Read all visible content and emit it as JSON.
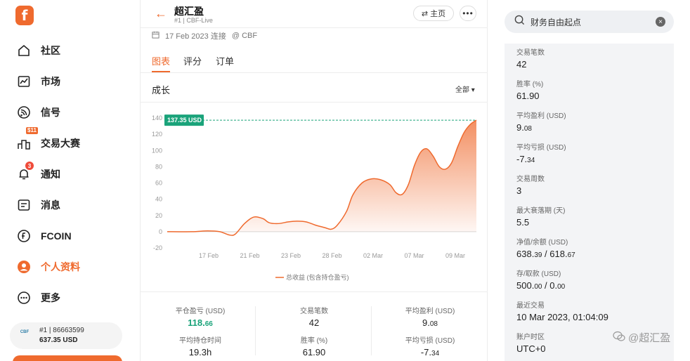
{
  "sidebar": {
    "logo_letter": "f",
    "items": [
      {
        "label": "社区",
        "icon": "home-icon"
      },
      {
        "label": "市场",
        "icon": "chart-icon"
      },
      {
        "label": "信号",
        "icon": "signal-icon"
      },
      {
        "label": "交易大赛",
        "icon": "podium-icon",
        "tag": "$11"
      },
      {
        "label": "通知",
        "icon": "bell-icon",
        "badge": "3"
      },
      {
        "label": "消息",
        "icon": "message-icon"
      },
      {
        "label": "FCOIN",
        "icon": "fcoin-icon"
      },
      {
        "label": "个人资料",
        "icon": "user-icon"
      },
      {
        "label": "更多",
        "icon": "more-icon"
      }
    ],
    "account": {
      "logo_text": "CBF",
      "id_line": "#1 | 86663599",
      "balance": "637.35 USD"
    }
  },
  "header": {
    "title": "超汇盈",
    "subtitle": "#1 | CBF-Live",
    "home_label": "⇄ 主页",
    "meta_date": "17 Feb 2023 连接",
    "meta_broker": "@ CBF"
  },
  "tabs": [
    "图表",
    "评分",
    "订单"
  ],
  "growth": {
    "title": "成长",
    "filter": "全部"
  },
  "chart_data": {
    "type": "area",
    "x_ticks": [
      "17 Feb",
      "21 Feb",
      "23 Feb",
      "28 Feb",
      "02 Mar",
      "07 Mar",
      "09 Mar"
    ],
    "y_ticks": [
      "140",
      "120",
      "100",
      "80",
      "60",
      "40",
      "20",
      "0",
      "-20"
    ],
    "ylim": [
      -20,
      140
    ],
    "series": [
      {
        "name": "总收益 (包含持仓盈亏)",
        "points": [
          [
            0,
            0
          ],
          [
            0.08,
            0
          ],
          [
            0.13,
            1
          ],
          [
            0.17,
            0
          ],
          [
            0.2,
            -4
          ],
          [
            0.22,
            -3
          ],
          [
            0.25,
            10
          ],
          [
            0.28,
            18
          ],
          [
            0.31,
            16
          ],
          [
            0.33,
            11
          ],
          [
            0.36,
            10
          ],
          [
            0.39,
            12
          ],
          [
            0.42,
            13
          ],
          [
            0.45,
            12
          ],
          [
            0.48,
            8
          ],
          [
            0.51,
            5
          ],
          [
            0.53,
            3
          ],
          [
            0.55,
            8
          ],
          [
            0.58,
            25
          ],
          [
            0.6,
            45
          ],
          [
            0.63,
            60
          ],
          [
            0.66,
            65
          ],
          [
            0.69,
            64
          ],
          [
            0.72,
            58
          ],
          [
            0.74,
            48
          ],
          [
            0.76,
            46
          ],
          [
            0.78,
            58
          ],
          [
            0.8,
            82
          ],
          [
            0.82,
            98
          ],
          [
            0.84,
            102
          ],
          [
            0.86,
            93
          ],
          [
            0.88,
            80
          ],
          [
            0.9,
            77
          ],
          [
            0.92,
            85
          ],
          [
            0.94,
            105
          ],
          [
            0.96,
            122
          ],
          [
            0.98,
            132
          ],
          [
            1.0,
            137.35
          ]
        ]
      }
    ],
    "current_value_label": "137.35 USD",
    "current_value": 137.35,
    "line_color": "#ef6a2e",
    "label_color": "#1aa37a"
  },
  "stats": [
    {
      "label": "平仓盈亏 (USD)",
      "value_main": "118.",
      "value_small": "66",
      "green": true
    },
    {
      "label": "交易笔数",
      "value_main": "42",
      "value_small": ""
    },
    {
      "label": "平均盈利 (USD)",
      "value_main": "9.",
      "value_small": "08"
    },
    {
      "label": "平均持仓时间",
      "value_main": "19.3h",
      "value_small": ""
    },
    {
      "label": "胜率 (%)",
      "value_main": "61.90",
      "value_small": ""
    },
    {
      "label": "平均亏损 (USD)",
      "value_main": "-7.",
      "value_small": "34"
    }
  ],
  "search": {
    "value": "财务自由起点"
  },
  "right_stats": [
    {
      "label": "交易笔数",
      "value_main": "42",
      "value_small": ""
    },
    {
      "label": "胜率 (%)",
      "value_main": "61.90",
      "value_small": ""
    },
    {
      "label": "平均盈利 (USD)",
      "value_main": "9.",
      "value_small": "08"
    },
    {
      "label": "平均亏损 (USD)",
      "value_main": "-7.",
      "value_small": "34"
    },
    {
      "label": "交易周数",
      "value_main": "3",
      "value_small": ""
    },
    {
      "label": "最大衰落期 (天)",
      "value_main": "5.5",
      "value_small": ""
    },
    {
      "label": "净值/余额 (USD)",
      "value_main": "638.",
      "value_small": "39",
      "value_main2": " / 618.",
      "value_small2": "67"
    },
    {
      "label": "存/取款 (USD)",
      "value_main": "500.",
      "value_small": "00",
      "value_main2": " / 0.",
      "value_small2": "00"
    },
    {
      "label": "最近交易",
      "value_main": "10 Mar 2023, 01:04:09",
      "value_small": ""
    },
    {
      "label": "账户时区",
      "value_main": "UTC+0",
      "value_small": ""
    }
  ],
  "watermark": "@超汇盈"
}
